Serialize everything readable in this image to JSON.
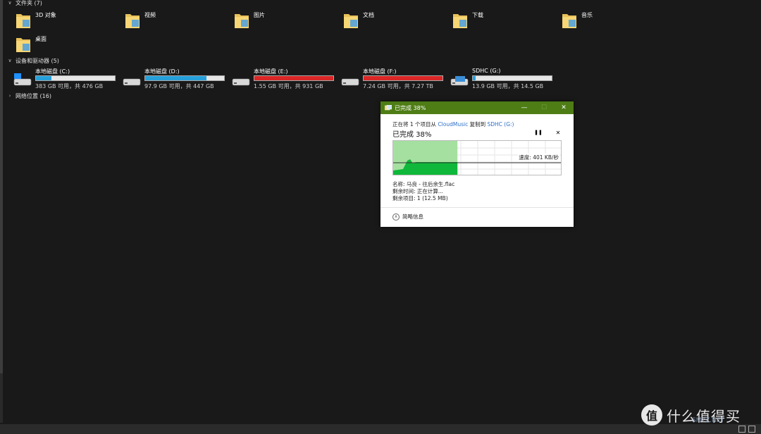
{
  "sections": {
    "folders_header": "文件夹 (7)",
    "drives_header": "设备和驱动器 (5)",
    "network_header": "网络位置 (16)"
  },
  "folders": [
    {
      "label": "3D 对象",
      "icon": "3d-objects-folder-icon"
    },
    {
      "label": "视频",
      "icon": "videos-folder-icon"
    },
    {
      "label": "图片",
      "icon": "pictures-folder-icon"
    },
    {
      "label": "文档",
      "icon": "documents-folder-icon"
    },
    {
      "label": "下载",
      "icon": "downloads-folder-icon"
    },
    {
      "label": "音乐",
      "icon": "music-folder-icon"
    },
    {
      "label": "桌面",
      "icon": "desktop-folder-icon"
    }
  ],
  "drives": [
    {
      "name": "本地磁盘 (C:)",
      "info": "383 GB 可用，共 476 GB",
      "used_fraction": 0.195,
      "bar_color": "#26a0da",
      "icon": "windows-drive-icon"
    },
    {
      "name": "本地磁盘 (D:)",
      "info": "97.9 GB 可用，共 447 GB",
      "used_fraction": 0.78,
      "bar_color": "#26a0da",
      "icon": "hard-drive-icon"
    },
    {
      "name": "本地磁盘 (E:)",
      "info": "1.55 GB 可用，共 931 GB",
      "used_fraction": 0.998,
      "bar_color": "#da2626",
      "icon": "hard-drive-icon"
    },
    {
      "name": "本地磁盘 (F:)",
      "info": "7.24 GB 可用，共 7.27 TB",
      "used_fraction": 0.999,
      "bar_color": "#da2626",
      "icon": "network-drive-icon"
    },
    {
      "name": "SDHC (G:)",
      "info": "13.9 GB 可用，共 14.5 GB",
      "used_fraction": 0.04,
      "bar_color": "#26a0da",
      "icon": "sd-card-drive-icon"
    }
  ],
  "dialog": {
    "title": "已完成 38%",
    "copy_prefix": "正在将 1 个项目从 ",
    "source": "CloudMusic",
    "copy_middle": " 复制到 ",
    "destination": "SDHC (G:)",
    "percent_label": "已完成 38%",
    "progress_fraction": 0.38,
    "speed": "速度: 401 KB/秒",
    "name_line": "名称: 马良 - 往后余生.flac",
    "time_line": "剩余时间: 正在计算...",
    "items_line": "剩余项目: 1 (12.5 MB)",
    "details_label": "简略信息",
    "min_glyph": "—",
    "max_glyph": "☐",
    "close_glyph": "✕",
    "pause_glyph": "❚❚",
    "cancel_glyph": "✕",
    "titlebar_color": "#4e7d15"
  },
  "watermark": {
    "logo": "值",
    "text": "什么值得买",
    "sub": "SMYZ.NET"
  }
}
